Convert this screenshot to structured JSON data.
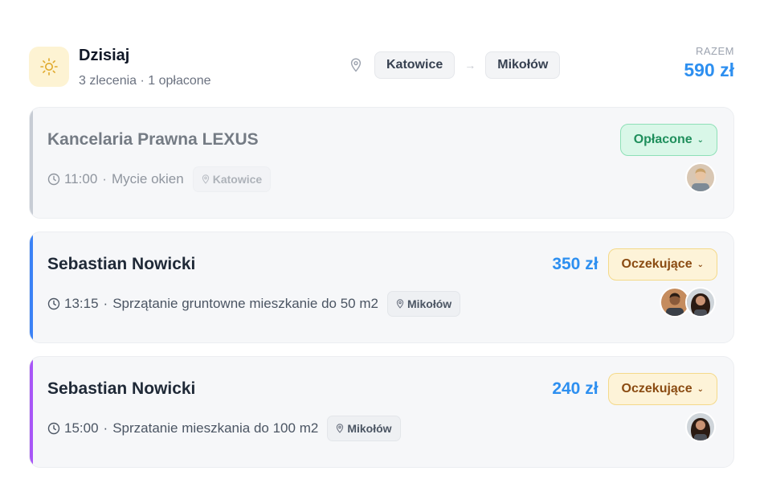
{
  "header": {
    "sun_icon": "sun-icon",
    "title": "Dzisiaj",
    "subtitle": "3 zlecenia · 1 opłacone",
    "route": {
      "pin_icon": "map-pin-icon",
      "from": "Katowice",
      "arrow": "→",
      "to": "Mikołów"
    },
    "total_label": "RAZEM",
    "total_amount": "590 zł"
  },
  "colors": {
    "accent_blue": "#2d8ff0",
    "stripe_gray": "#c7ccd4",
    "stripe_blue": "#3b82f6",
    "stripe_purple": "#a855f7",
    "paid_bg": "#d9f7e8",
    "pending_bg": "#fdf3d8"
  },
  "orders": [
    {
      "client": "Kancelaria Prawna LEXUS",
      "time": "11:00",
      "separator": "·",
      "service": "Mycie okien",
      "location": "Katowice",
      "price": "",
      "status": "Opłacone",
      "status_chevron": "⌄",
      "avatars": [
        "avatar-man-blond"
      ]
    },
    {
      "client": "Sebastian Nowicki",
      "time": "13:15",
      "separator": "·",
      "service": "Sprzątanie gruntowne mieszkanie do 50 m2",
      "location": "Mikołów",
      "price": "350 zł",
      "status": "Oczekujące",
      "status_chevron": "⌄",
      "avatars": [
        "avatar-man-dark",
        "avatar-woman-curly"
      ]
    },
    {
      "client": "Sebastian Nowicki",
      "time": "15:00",
      "separator": "·",
      "service": "Sprzatanie mieszkania do 100 m2",
      "location": "Mikołów",
      "price": "240 zł",
      "status": "Oczekujące",
      "status_chevron": "⌄",
      "avatars": [
        "avatar-woman-curly"
      ]
    }
  ]
}
